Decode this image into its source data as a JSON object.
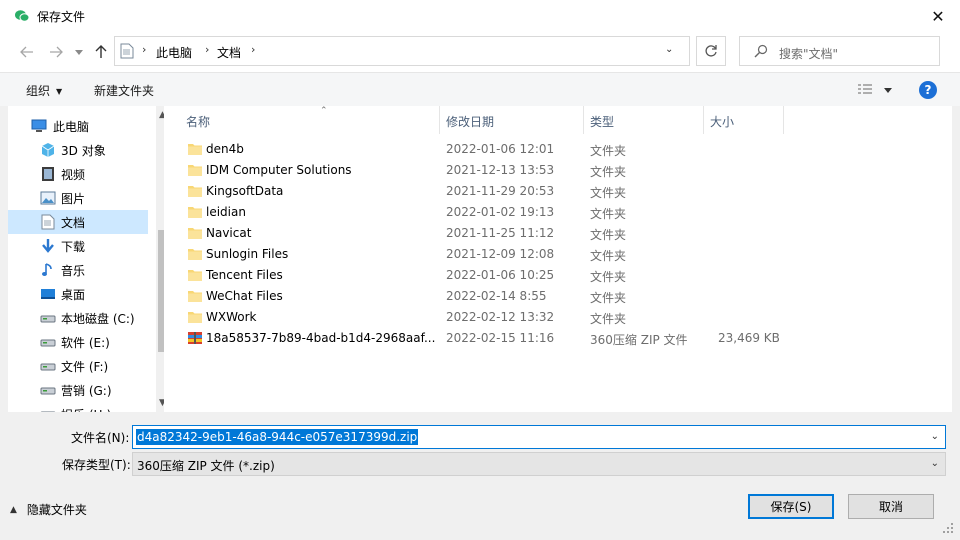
{
  "window": {
    "title": "保存文件",
    "close_glyph": "✕"
  },
  "nav": {
    "back_icon": "back-arrow-icon",
    "forward_icon": "forward-arrow-icon",
    "recent_icon": "chevron-down-icon",
    "up_icon": "up-arrow-icon",
    "breadcrumb": [
      "此电脑",
      "文档"
    ],
    "refresh_icon": "refresh-icon",
    "search_placeholder": "搜索\"文档\""
  },
  "toolbar": {
    "organize": "组织",
    "new_folder": "新建文件夹",
    "help": "?"
  },
  "sidebar": {
    "items": [
      {
        "label": "此电脑",
        "icon": "computer-icon"
      },
      {
        "label": "3D 对象",
        "icon": "cube-icon"
      },
      {
        "label": "视频",
        "icon": "video-icon"
      },
      {
        "label": "图片",
        "icon": "picture-icon"
      },
      {
        "label": "文档",
        "icon": "document-icon",
        "selected": true
      },
      {
        "label": "下载",
        "icon": "download-icon"
      },
      {
        "label": "音乐",
        "icon": "music-icon"
      },
      {
        "label": "桌面",
        "icon": "desktop-icon"
      },
      {
        "label": "本地磁盘 (C:)",
        "icon": "drive-icon"
      },
      {
        "label": "软件 (E:)",
        "icon": "drive-icon"
      },
      {
        "label": "文件 (F:)",
        "icon": "drive-icon"
      },
      {
        "label": "营销 (G:)",
        "icon": "drive-icon"
      },
      {
        "label": "娱乐 (H:)",
        "icon": "drive-icon"
      }
    ]
  },
  "columns": {
    "name": "名称",
    "date": "修改日期",
    "type": "类型",
    "size": "大小"
  },
  "files": [
    {
      "name": "den4b",
      "date": "2022-01-06 12:01",
      "type": "文件夹",
      "size": "",
      "icon": "folder-icon"
    },
    {
      "name": "IDM Computer Solutions",
      "date": "2021-12-13 13:53",
      "type": "文件夹",
      "size": "",
      "icon": "folder-icon"
    },
    {
      "name": "KingsoftData",
      "date": "2021-11-29 20:53",
      "type": "文件夹",
      "size": "",
      "icon": "folder-icon"
    },
    {
      "name": "leidian",
      "date": "2022-01-02 19:13",
      "type": "文件夹",
      "size": "",
      "icon": "folder-icon"
    },
    {
      "name": "Navicat",
      "date": "2021-11-25 11:12",
      "type": "文件夹",
      "size": "",
      "icon": "folder-icon"
    },
    {
      "name": "Sunlogin Files",
      "date": "2021-12-09 12:08",
      "type": "文件夹",
      "size": "",
      "icon": "folder-icon"
    },
    {
      "name": "Tencent Files",
      "date": "2022-01-06 10:25",
      "type": "文件夹",
      "size": "",
      "icon": "folder-icon"
    },
    {
      "name": "WeChat Files",
      "date": "2022-02-14 8:55",
      "type": "文件夹",
      "size": "",
      "icon": "folder-icon"
    },
    {
      "name": "WXWork",
      "date": "2022-02-12 13:32",
      "type": "文件夹",
      "size": "",
      "icon": "folder-icon"
    },
    {
      "name": "18a58537-7b89-4bad-b1d4-2968aaf...",
      "date": "2022-02-15 11:16",
      "type": "360压缩 ZIP 文件",
      "size": "23,469 KB",
      "icon": "zip-archive-icon"
    }
  ],
  "filename": {
    "label": "文件名(N):",
    "value": "d4a82342-9eb1-46a8-944c-e057e317399d.zip"
  },
  "filetype": {
    "label": "保存类型(T):",
    "value": "360压缩 ZIP 文件 (*.zip)"
  },
  "footer": {
    "hide_folders": "隐藏文件夹",
    "save": "保存(S)",
    "cancel": "取消"
  },
  "colors": {
    "accent": "#0078d7",
    "selected_bg": "#cde8ff",
    "folder": "#f8d775"
  }
}
